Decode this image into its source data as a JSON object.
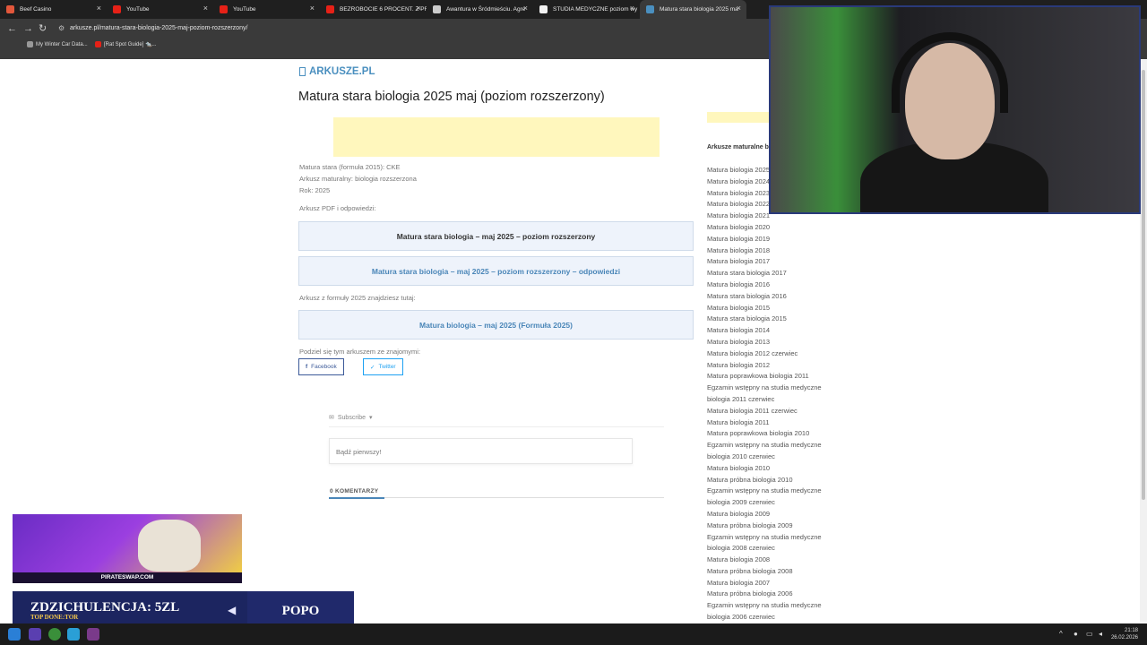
{
  "browser": {
    "tabs": [
      {
        "label": "Beef Casino",
        "color": "#e2573b"
      },
      {
        "label": "YouTube",
        "color": "#e62117"
      },
      {
        "label": "YouTube",
        "color": "#e62117"
      },
      {
        "label": "BEZROBOCIE 6 PROCENT. Z PR",
        "color": "#e62117"
      },
      {
        "label": "Awantura w Śródmieściu. Agre",
        "color": "#cccccc"
      },
      {
        "label": "STUDIA MEDYCZNE poziom wy",
        "color": "#f1f1f1"
      },
      {
        "label": "Matura stara biologia 2025 ma",
        "color": "#4a8fbf"
      }
    ],
    "url": "arkusze.pl/matura-stara-biologia-2025-maj-poziom-rozszerzony/",
    "bookmarks": [
      "My Winter Car Data...",
      "[Rat Spot Guide] 🐀..."
    ]
  },
  "page": {
    "logo": "ARKUSZE.PL",
    "title": "Matura stara biologia 2025 maj (poziom rozszerzony)",
    "meta": [
      "Matura stara (formuła 2015): CKE",
      "Arkusz maturalny: biologia rozszerzona",
      "Rok: 2025"
    ],
    "pdf_label": "Arkusz PDF i odpowiedzi:",
    "btn_exam": "Matura stara biologia – maj 2025 – poziom rozszerzony",
    "btn_answers": "Matura stara biologia – maj 2025 – poziom rozszerzony – odpowiedzi",
    "formula_label": "Arkusz z formuły 2025 znajdziesz tutaj:",
    "btn_formula": "Matura biologia – maj 2025 (Formuła 2025)",
    "share_label": "Podziel się tym arkuszem ze znajomymi:",
    "share_facebook": "Facebook",
    "share_twitter": "Twitter",
    "subscribe": "Subscribe",
    "comment_placeholder": "Bądź pierwszy!",
    "comments_count": "0 KOMENTARZY"
  },
  "sidebar": {
    "heading": "Arkusze maturalne bi",
    "items": [
      "Matura biologia 2025",
      "Matura biologia 2024",
      "Matura biologia 2023",
      "Matura biologia 2022",
      "Matura biologia 2021",
      "Matura biologia 2020",
      "Matura biologia 2019",
      "Matura biologia 2018",
      "Matura biologia 2017",
      "Matura stara biologia 2017",
      "Matura biologia 2016",
      "Matura stara biologia 2016",
      "Matura biologia 2015",
      "Matura stara biologia 2015",
      "Matura biologia 2014",
      "Matura biologia 2013",
      "Matura biologia 2012 czerwiec",
      "Matura biologia 2012",
      "Matura poprawkowa biologia 2011",
      "Egzamin wstępny na studia medyczne",
      "biologia 2011 czerwiec",
      "Matura biologia 2011 czerwiec",
      "Matura biologia 2011",
      "Matura poprawkowa biologia 2010",
      "Egzamin wstępny na studia medyczne",
      "biologia 2010 czerwiec",
      "Matura biologia 2010",
      "Matura próbna biologia 2010",
      "Egzamin wstępny na studia medyczne",
      "biologia 2009 czerwiec",
      "Matura biologia 2009",
      "Matura próbna biologia 2009",
      "Egzamin wstępny na studia medyczne",
      "biologia 2008 czerwiec",
      "Matura biologia 2008",
      "Matura próbna biologia 2008",
      "Matura biologia 2007",
      "Matura próbna biologia 2006",
      "Egzamin wstępny na studia medyczne",
      "biologia 2006 czerwiec"
    ]
  },
  "overlay": {
    "promo_label": "PIRATESWAP.COM",
    "banner_main": "ZDZICHULENCJA: 5ZL",
    "banner_sub": "TOP DONE:TOR",
    "banner_right": "POPO"
  },
  "taskbar": {
    "time": "21:18",
    "date": "26.02.2026"
  }
}
